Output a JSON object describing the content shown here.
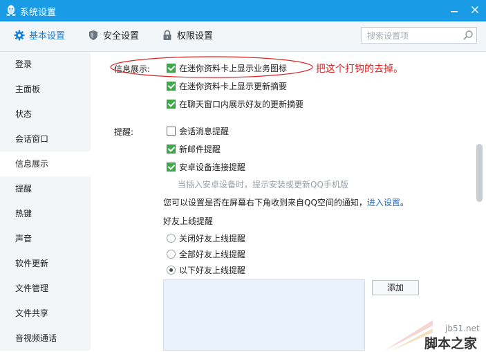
{
  "window": {
    "title": "系统设置",
    "accent": "#1a9be6",
    "minimize_icon": "minimize-icon",
    "close_icon": "close-icon"
  },
  "tabs": [
    {
      "label": "基本设置",
      "icon": "gear-icon",
      "active": true
    },
    {
      "label": "安全设置",
      "icon": "shield-icon",
      "active": false
    },
    {
      "label": "权限设置",
      "icon": "lock-icon",
      "active": false
    }
  ],
  "search": {
    "placeholder": "搜索设置项",
    "value": "",
    "icon": "search-icon"
  },
  "sidebar": {
    "items": [
      {
        "label": "登录"
      },
      {
        "label": "主面板"
      },
      {
        "label": "状态"
      },
      {
        "label": "会话窗口"
      },
      {
        "label": "信息展示",
        "active": true
      },
      {
        "label": "提醒"
      },
      {
        "label": "热键"
      },
      {
        "label": "声音"
      },
      {
        "label": "软件更新"
      },
      {
        "label": "文件管理"
      },
      {
        "label": "文件共享"
      },
      {
        "label": "音视频通话"
      }
    ]
  },
  "info_display": {
    "label": "信息展示:",
    "options": [
      {
        "label": "在迷你资料卡上显示业务图标",
        "checked": true
      },
      {
        "label": "在迷你资料卡上显示更新摘要",
        "checked": true
      },
      {
        "label": "在聊天窗口内展示好友的更新摘要",
        "checked": true
      }
    ]
  },
  "reminders": {
    "label": "提醒:",
    "options": [
      {
        "label": "会话消息提醒",
        "checked": false
      },
      {
        "label": "新邮件提醒",
        "checked": true
      },
      {
        "label": "安卓设备连接提醒",
        "checked": true
      }
    ],
    "hint": "当插入安卓设备时，提示安装或更新QQ手机版",
    "notify_text": "您可以设置是否在屏幕右下角收到来自QQ空间的通知，",
    "notify_link": "进入设置",
    "notify_end": "。"
  },
  "friend_online": {
    "title": "好友上线提醒",
    "options": [
      {
        "label": "关闭好友上线提醒",
        "selected": false
      },
      {
        "label": "全部好友上线提醒",
        "selected": false
      },
      {
        "label": "以下好友上线提醒",
        "selected": true
      }
    ],
    "add_button": "添加"
  },
  "annotation": {
    "text": "把这个打钩的去掉。",
    "color": "#e02020"
  },
  "watermark": {
    "site": "jb51.net",
    "name": "脚本之家"
  }
}
